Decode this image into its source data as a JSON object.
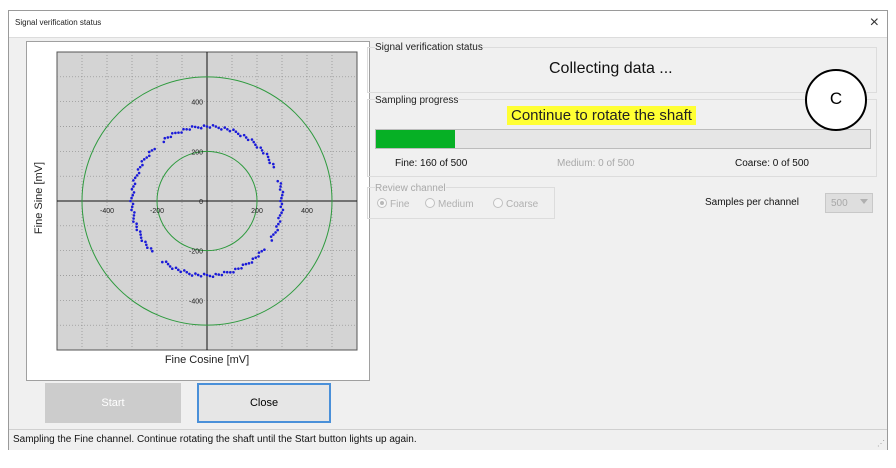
{
  "window": {
    "title": "Signal verification status",
    "close_glyph": "×"
  },
  "plot": {
    "ylabel": "Fine Sine [mV]",
    "xlabel": "Fine Cosine [mV]",
    "x_ticks": [
      "-400",
      "-200",
      "0",
      "200",
      "400"
    ],
    "y_ticks": [
      "400",
      "200",
      "0",
      "-200",
      "-400"
    ],
    "colors": {
      "background": "#d4d4d4",
      "reference_circle": "#2e9a3e",
      "samples": "#1a1ad8"
    }
  },
  "chart_data": {
    "type": "scatter",
    "xlabel": "Fine Cosine [mV]",
    "ylabel": "Fine Sine [mV]",
    "xlim": [
      -600,
      600
    ],
    "ylim": [
      -600,
      600
    ],
    "grid": true,
    "reference_circles_mV": [
      200,
      500
    ],
    "samples": {
      "shape": "circle",
      "radius_mV": 300,
      "count": 160
    }
  },
  "buttons": {
    "start": "Start",
    "close": "Close"
  },
  "status_group": {
    "label": "Signal verification status",
    "message": "Collecting data ..."
  },
  "sampling_group": {
    "label": "Sampling progress",
    "instruction": "Continue to rotate the shaft",
    "progress_fraction": 0.16,
    "fine": "Fine: 160 of 500",
    "medium": "Medium: 0 of 500",
    "coarse": "Coarse: 0 of 500"
  },
  "review_channel": {
    "label": "Review channel",
    "options": [
      "Fine",
      "Medium",
      "Coarse"
    ],
    "selected": "Fine"
  },
  "samples_per_channel": {
    "label": "Samples per channel",
    "value": "500"
  },
  "annotation": {
    "letter": "C"
  },
  "statusbar": {
    "text": "Sampling the Fine channel. Continue rotating the shaft until the Start button lights up again."
  }
}
